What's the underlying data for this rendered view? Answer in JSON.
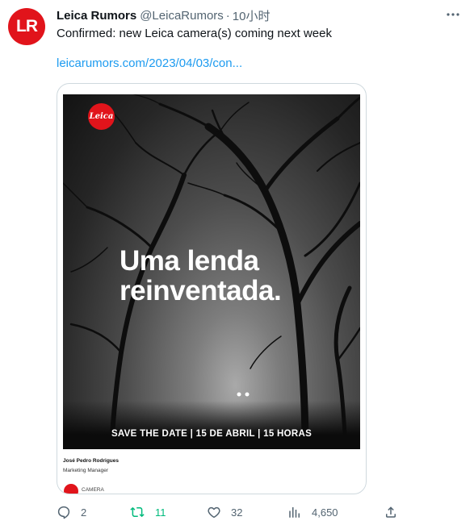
{
  "tweet": {
    "avatar_text": "LR",
    "display_name": "Leica Rumors",
    "handle": "@LeicaRumors",
    "separator": "·",
    "time": "10小时",
    "text": "Confirmed: new Leica camera(s) coming next week",
    "link": "leicarumors.com/2023/04/03/con..."
  },
  "card": {
    "logo_text": "Leica",
    "headline_line1": "Uma lenda",
    "headline_line2": "reinventada.",
    "save_the_date": "SAVE THE DATE | 15 DE ABRIL | 15 HORAS",
    "signature_name": "José Pedro Rodrigues",
    "signature_title": "Marketing Manager",
    "signature_brand": "CAMERA"
  },
  "actions": {
    "replies": "2",
    "retweets": "11",
    "likes": "32",
    "views": "4,650"
  },
  "colors": {
    "brand_red": "#e1141b",
    "link_blue": "#1d9bf0",
    "retweet_green": "#00ba7c",
    "secondary_text": "#536471"
  },
  "icons": [
    "more-icon",
    "reply-icon",
    "retweet-icon",
    "like-icon",
    "views-icon",
    "share-icon"
  ]
}
